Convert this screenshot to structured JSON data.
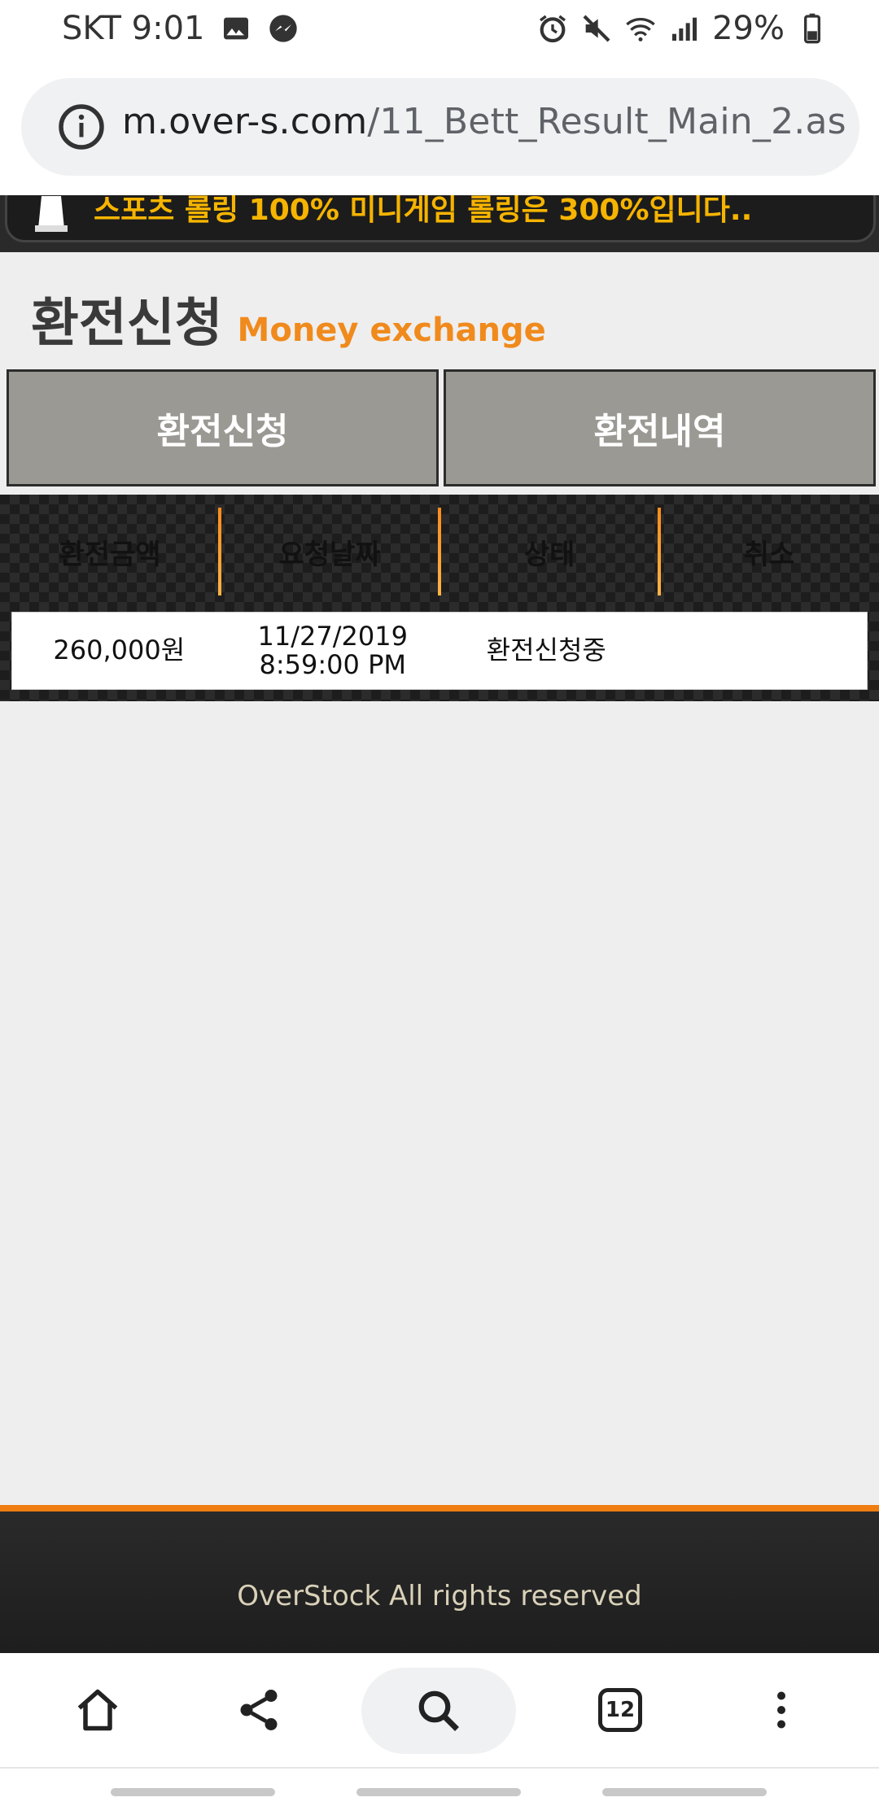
{
  "status_bar": {
    "carrier_time": "SKT 9:01",
    "battery": "29%"
  },
  "browser": {
    "url_domain": "m.over-s.com",
    "url_path": "/11_Bett_Result_Main_2.as",
    "tab_count": "12"
  },
  "notice": {
    "text": "스포츠 롤링 100% 미니게임 롤링은 300%입니다.."
  },
  "page": {
    "title_ko": "환전신청",
    "title_en": "Money exchange",
    "tabs": [
      {
        "label": "환전신청"
      },
      {
        "label": "환전내역"
      }
    ],
    "table": {
      "headers": [
        "환전금액",
        "요청날짜",
        "상태",
        "취소"
      ],
      "rows": [
        {
          "amount": "260,000원",
          "date": "11/27/2019",
          "time": "8:59:00 PM",
          "status": "환전신청중",
          "cancel": ""
        }
      ]
    }
  },
  "footer": {
    "text": "OverStock All rights reserved"
  },
  "colors": {
    "accent": "#f08a1c",
    "notice_text": "#f6b400",
    "tab_bg": "#9a9994"
  }
}
